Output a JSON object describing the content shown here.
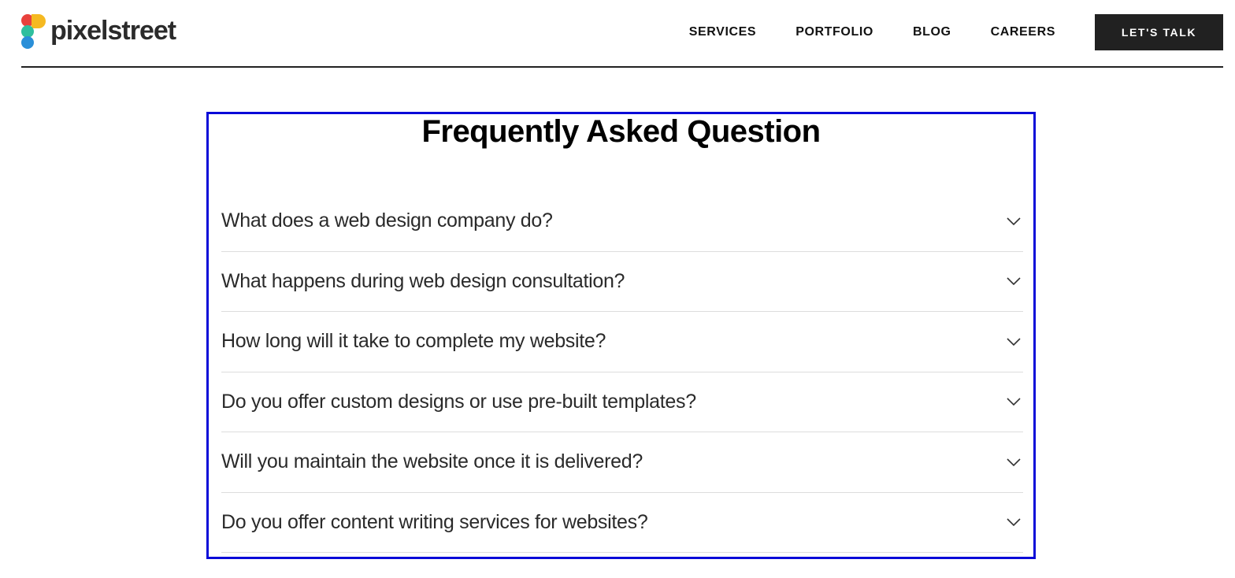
{
  "brand": {
    "name": "pixelstreet",
    "logo_colors": [
      "#e8413c",
      "#f5b921",
      "#2fbf9e",
      "#2a8fd8"
    ]
  },
  "nav": {
    "items": [
      {
        "label": "SERVICES"
      },
      {
        "label": "PORTFOLIO"
      },
      {
        "label": "BLOG"
      },
      {
        "label": "CAREERS"
      }
    ],
    "cta_label": "LET'S TALK"
  },
  "faq": {
    "title": "Frequently Asked Question",
    "border_color": "#0a0ad8",
    "items": [
      {
        "question": "What does a web design company do?",
        "icon": "chevron-down-icon"
      },
      {
        "question": "What happens during web design consultation?",
        "icon": "chevron-down-icon"
      },
      {
        "question": "How long will it take to complete my website?",
        "icon": "chevron-down-icon"
      },
      {
        "question": "Do you offer custom designs or use pre-built templates?",
        "icon": "chevron-down-icon"
      },
      {
        "question": "Will you maintain the website once it is delivered?",
        "icon": "chevron-down-icon"
      },
      {
        "question": "Do you offer content writing services for websites?",
        "icon": "chevron-down-icon"
      }
    ]
  }
}
